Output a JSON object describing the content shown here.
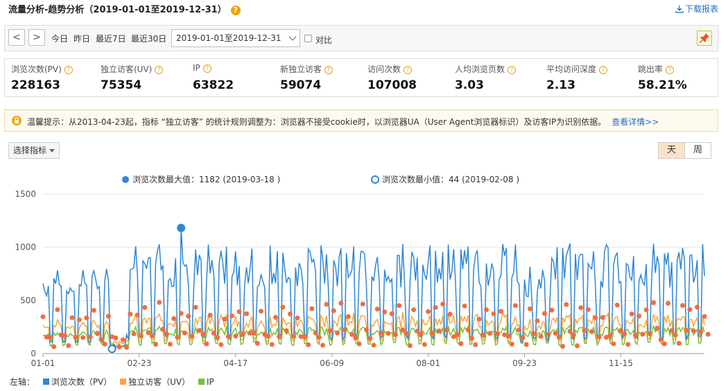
{
  "header": {
    "title": "流量分析-趋势分析（2019-01-01至2019-12-31）",
    "download_label": "下载报表"
  },
  "toolbar": {
    "prev": "<",
    "next": ">",
    "quick_ranges": [
      "今日",
      "昨日",
      "最近7日",
      "最近30日"
    ],
    "date_range": "2019-01-01至2019-12-31",
    "compare_label": "对比"
  },
  "metrics": [
    {
      "label": "浏览次数(PV)",
      "value": "228163"
    },
    {
      "label": "独立访客(UV)",
      "value": "75354"
    },
    {
      "label": "IP",
      "value": "63822"
    },
    {
      "label": "新独立访客",
      "value": "59074"
    },
    {
      "label": "访问次数",
      "value": "107008"
    },
    {
      "label": "人均浏览页数",
      "value": "3.03"
    },
    {
      "label": "平均访问深度",
      "value": "2.13"
    },
    {
      "label": "跳出率",
      "value": "58.21%"
    }
  ],
  "tip": {
    "text": "温馨提示：从2013-04-23起，指标 “独立访客” 的统计规则调整为：浏览器不接受cookie时，以浏览器UA（User Agent浏览器标识）及访客IP为识别依据。",
    "link": "查看详情>>"
  },
  "controls": {
    "metric_selector": "选择指标",
    "granularity": [
      "天",
      "周"
    ],
    "active_granularity": "天"
  },
  "chart_data": {
    "type": "line",
    "x": [
      "01-01",
      "02-23",
      "04-17",
      "06-09",
      "08-01",
      "09-23",
      "11-15"
    ],
    "ylim": [
      0,
      1500
    ],
    "yticks": [
      0,
      500,
      1000,
      1500
    ],
    "max_label": "浏览次数最大值：1182 (2019-03-18 )",
    "min_label": "浏览次数最小值：44 (2019-02-08 )",
    "max_point": {
      "date": "2019-03-18",
      "value": 1182
    },
    "min_point": {
      "date": "2019-02-08",
      "value": 44
    },
    "axis_legend_prefix": "左轴：",
    "series": [
      {
        "name": "浏览次数（PV）",
        "color": "#2f86d4"
      },
      {
        "name": "独立访客（UV）",
        "color": "#f4a940"
      },
      {
        "name": "IP",
        "color": "#73c23a"
      }
    ],
    "highlight_color": "#f36c3f"
  }
}
